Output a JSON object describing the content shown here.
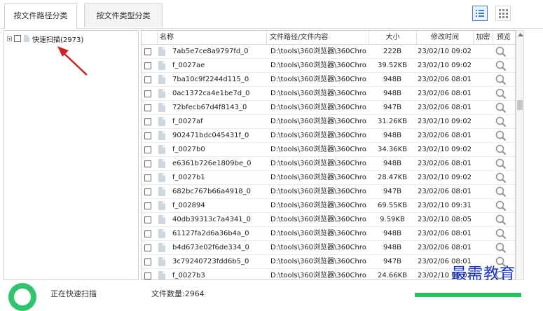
{
  "tabs": [
    {
      "label": "按文件路径分类",
      "active": true
    },
    {
      "label": "按文件类型分类",
      "active": false
    }
  ],
  "tree": {
    "label": "快速扫描(2973)"
  },
  "table": {
    "headers": {
      "name": "名称",
      "path": "文件路径/文件内容",
      "size": "大小",
      "modified": "修改时间",
      "encrypted": "加密",
      "preview": "预览"
    },
    "rows": [
      {
        "name": "7ab5e7ce8a9797fd_0",
        "path": "D:\\tools\\360浏览器\\360Chro...",
        "size": "222B",
        "date": "23/02/10 09:02"
      },
      {
        "name": "f_0027ae",
        "path": "D:\\tools\\360浏览器\\360Chro...",
        "size": "39.52KB",
        "date": "23/02/10 09:02"
      },
      {
        "name": "7ba10c9f2244d115_0",
        "path": "D:\\tools\\360浏览器\\360Chro...",
        "size": "948B",
        "date": "23/02/06 08:01"
      },
      {
        "name": "0ac1372ca4e1be7d_0",
        "path": "D:\\tools\\360浏览器\\360Chro...",
        "size": "948B",
        "date": "23/02/06 08:01"
      },
      {
        "name": "72bfecb67d4f8143_0",
        "path": "D:\\tools\\360浏览器\\360Chro...",
        "size": "947B",
        "date": "23/02/06 08:01"
      },
      {
        "name": "f_0027af",
        "path": "D:\\tools\\360浏览器\\360Chro...",
        "size": "31.26KB",
        "date": "23/02/10 09:02"
      },
      {
        "name": "902471bdc045431f_0",
        "path": "D:\\tools\\360浏览器\\360Chro...",
        "size": "948B",
        "date": "23/02/06 08:01"
      },
      {
        "name": "f_0027b0",
        "path": "D:\\tools\\360浏览器\\360Chro...",
        "size": "34.36KB",
        "date": "23/02/10 09:02"
      },
      {
        "name": "e6361b726e1809be_0",
        "path": "D:\\tools\\360浏览器\\360Chro...",
        "size": "948B",
        "date": "23/02/06 08:01"
      },
      {
        "name": "f_0027b1",
        "path": "D:\\tools\\360浏览器\\360Chro...",
        "size": "28.47KB",
        "date": "23/02/10 09:02"
      },
      {
        "name": "682bc767b66a4918_0",
        "path": "D:\\tools\\360浏览器\\360Chro...",
        "size": "947B",
        "date": "23/02/06 08:01"
      },
      {
        "name": "f_002894",
        "path": "D:\\tools\\360浏览器\\360Chro...",
        "size": "69.55KB",
        "date": "23/02/10 09:31"
      },
      {
        "name": "40db39313c7a4341_0",
        "path": "D:\\tools\\360浏览器\\360Chro...",
        "size": "9.59KB",
        "date": "23/02/10 08:05"
      },
      {
        "name": "61127fa2d6a36b4a_0",
        "path": "D:\\tools\\360浏览器\\360Chro...",
        "size": "948B",
        "date": "23/02/06 08:01"
      },
      {
        "name": "b4d673e02f6de334_0",
        "path": "D:\\tools\\360浏览器\\360Chro...",
        "size": "948B",
        "date": "23/02/06 08:01"
      },
      {
        "name": "3c79240723fdd6b5_0",
        "path": "D:\\tools\\360浏览器\\360Chro...",
        "size": "947B",
        "date": "23/02/06 08:01"
      },
      {
        "name": "f_0027b3",
        "path": "D:\\tools\\360浏览器\\360Chro...",
        "size": "24.66KB",
        "date": "23/02/10 09:02"
      }
    ]
  },
  "footer": {
    "status": "正在快速扫描",
    "file_count": "文件数量:2964"
  },
  "watermark": "最需教育",
  "colors": {
    "accent": "#3a7bd5",
    "arrow": "#d21f1f",
    "progress": "#27c25d",
    "watermark": "#1432c8"
  }
}
